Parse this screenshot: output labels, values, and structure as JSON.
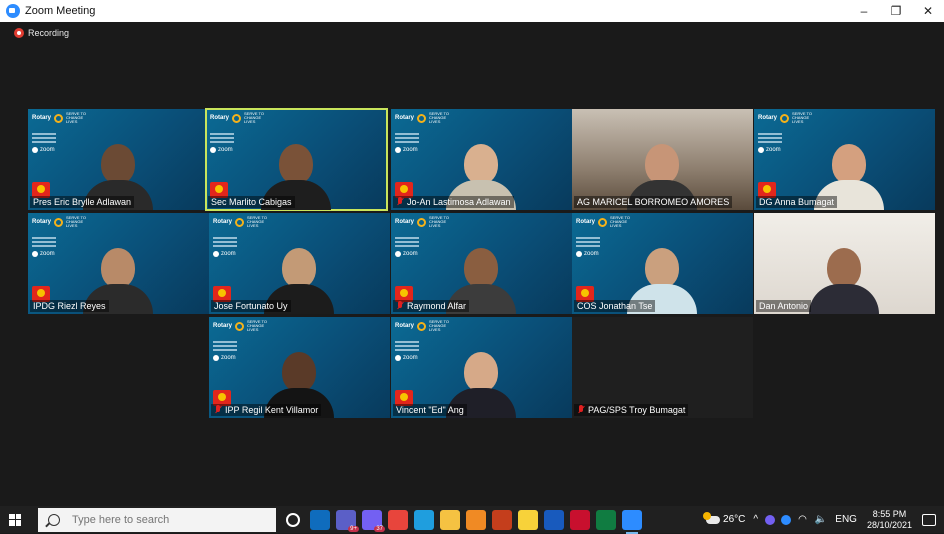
{
  "window": {
    "title": "Zoom Meeting",
    "controls": {
      "minimize": "–",
      "restore": "❐",
      "close": "✕"
    }
  },
  "meeting": {
    "recording_label": "Recording",
    "banner_rotary": "Rotary",
    "banner_tagline": "SERVE TO CHANGE LIVES",
    "zoom_word": "zoom",
    "participants": [
      {
        "name": "Pres Eric Brylle Adlawan",
        "muted": false,
        "active": false
      },
      {
        "name": "Sec Marlito Cabigas",
        "muted": false,
        "active": true
      },
      {
        "name": "Jo-An Lastimosa Adlawan",
        "muted": true,
        "active": false
      },
      {
        "name": "AG MARICEL BORROMEO AMORES",
        "muted": false,
        "active": false
      },
      {
        "name": "DG Anna Bumagat",
        "muted": false,
        "active": false
      },
      {
        "name": "IPDG Riezl Reyes",
        "muted": false,
        "active": false
      },
      {
        "name": "Jose Fortunato Uy",
        "muted": false,
        "active": false
      },
      {
        "name": "Raymond Alfar",
        "muted": true,
        "active": false
      },
      {
        "name": "COS Jonathan Tse",
        "muted": false,
        "active": false
      },
      {
        "name": "Dan Antonio",
        "muted": false,
        "active": false
      },
      {
        "name": "IPP Regil Kent Villamor",
        "muted": true,
        "active": false
      },
      {
        "name": "Vincent \"Ed\" Ang",
        "muted": false,
        "active": false
      },
      {
        "name": "PAG/SPS Troy Bumagat",
        "muted": true,
        "active": false
      }
    ]
  },
  "taskbar": {
    "search_placeholder": "Type here to search",
    "apps": [
      {
        "icon": "cortana-icon"
      },
      {
        "icon": "outlook-icon",
        "color": "#0f6cbd"
      },
      {
        "icon": "teams-icon",
        "color": "#5b5fc7",
        "badge": "9+"
      },
      {
        "icon": "viber-icon",
        "color": "#7360f2",
        "badge": "37"
      },
      {
        "icon": "chrome-icon",
        "color": "#e8453c"
      },
      {
        "icon": "edge-icon",
        "color": "#1f9ede"
      },
      {
        "icon": "file-explorer-icon",
        "color": "#f5c242"
      },
      {
        "icon": "vlc-icon",
        "color": "#f08a24"
      },
      {
        "icon": "powerpoint-icon",
        "color": "#c43e1c"
      },
      {
        "icon": "sticky-notes-icon",
        "color": "#f7d23a"
      },
      {
        "icon": "word-icon",
        "color": "#185abd"
      },
      {
        "icon": "wps-icon",
        "color": "#c8102e"
      },
      {
        "icon": "excel-icon",
        "color": "#107c41"
      },
      {
        "icon": "zoom-icon",
        "color": "#2d8cff",
        "active": true
      }
    ],
    "weather": "26°C",
    "language": "ENG",
    "time": "8:55 PM",
    "date": "28/10/2021"
  }
}
